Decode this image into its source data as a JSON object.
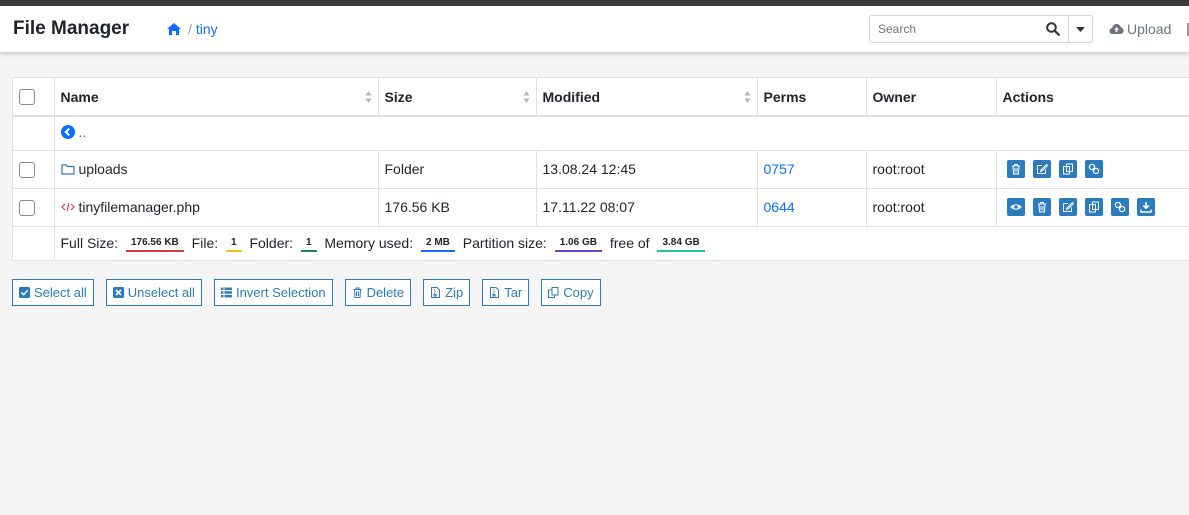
{
  "app": {
    "title": "File Manager"
  },
  "breadcrumb": {
    "separator": "/",
    "current": "tiny"
  },
  "search": {
    "placeholder": "Search"
  },
  "header_actions": {
    "upload_label": "Upload"
  },
  "table": {
    "columns": [
      "Name",
      "Size",
      "Modified",
      "Perms",
      "Owner",
      "Actions"
    ],
    "parent_link": "..",
    "rows": [
      {
        "name": "uploads",
        "type": "folder",
        "size": "Folder",
        "modified": "13.08.24 12:45",
        "perms": "0757",
        "owner": "root:root"
      },
      {
        "name": "tinyfilemanager.php",
        "type": "file",
        "size": "176.56 KB",
        "modified": "17.11.22 08:07",
        "perms": "0644",
        "owner": "root:root"
      }
    ],
    "footer": {
      "full_size_label": "Full Size:",
      "full_size": "176.56 KB",
      "file_label": "File:",
      "file_count": "1",
      "folder_label": "Folder:",
      "folder_count": "1",
      "memory_label": "Memory used:",
      "memory": "2 MB",
      "partition_label": "Partition size:",
      "partition": "1.06 GB",
      "free_of_label": "free of",
      "total": "3.84 GB"
    }
  },
  "bulk_actions": {
    "select_all": "Select all",
    "unselect_all": "Unselect all",
    "invert_selection": "Invert Selection",
    "delete": "Delete",
    "zip": "Zip",
    "tar": "Tar",
    "copy": "Copy"
  },
  "colors": {
    "accent": "#2b7bbf",
    "link": "#0d6efd",
    "badge_size": "#dc3545",
    "badge_file": "#ffc107",
    "badge_folder": "#198754",
    "badge_memory": "#0d6efd",
    "badge_partition": "#6f42c1",
    "badge_total": "#20c997"
  }
}
